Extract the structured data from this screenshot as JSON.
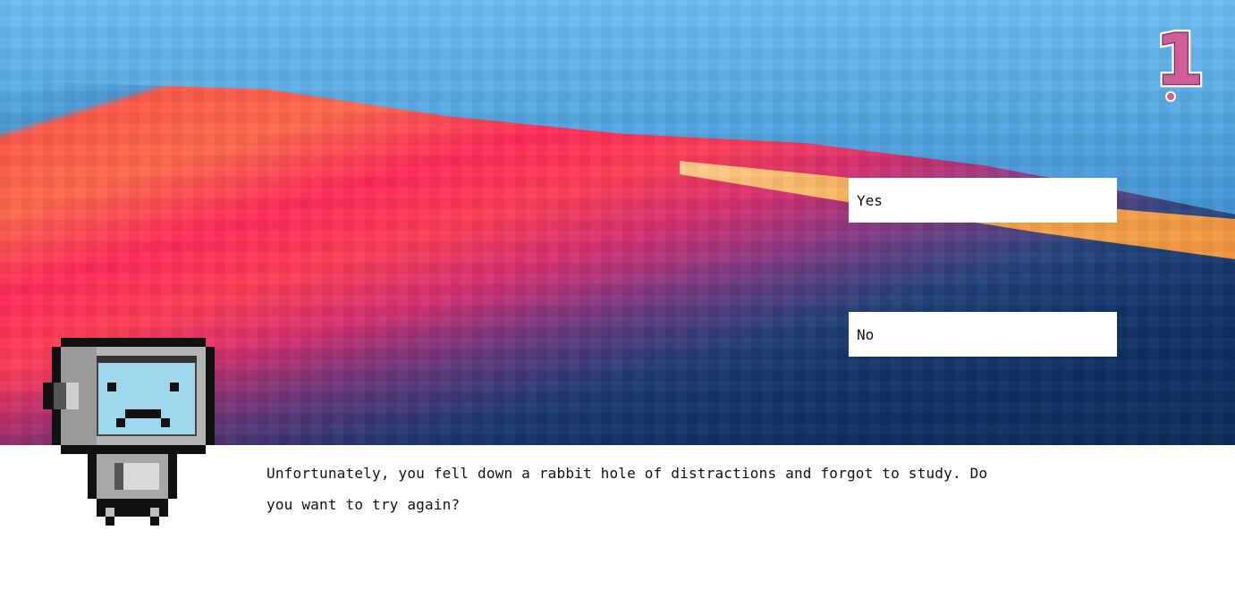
{
  "game": {
    "level_badge": "1",
    "choices": {
      "yes_label": "Yes",
      "no_label": "No"
    },
    "dialogue": {
      "text": "Unfortunately, you fell down a rabbit hole of distractions and forgot to study. Do you want to try again?"
    },
    "character": {
      "name_icon": "robot-character-sad",
      "expression": "sad"
    },
    "colors": {
      "badge_fill": "#cf5f98",
      "badge_outline": "#7a2a66",
      "panel_bg": "#ffffff",
      "button_bg": "#ffffff",
      "robot_screen": "#9fd8ee",
      "robot_body": "#b7b7b7"
    }
  }
}
